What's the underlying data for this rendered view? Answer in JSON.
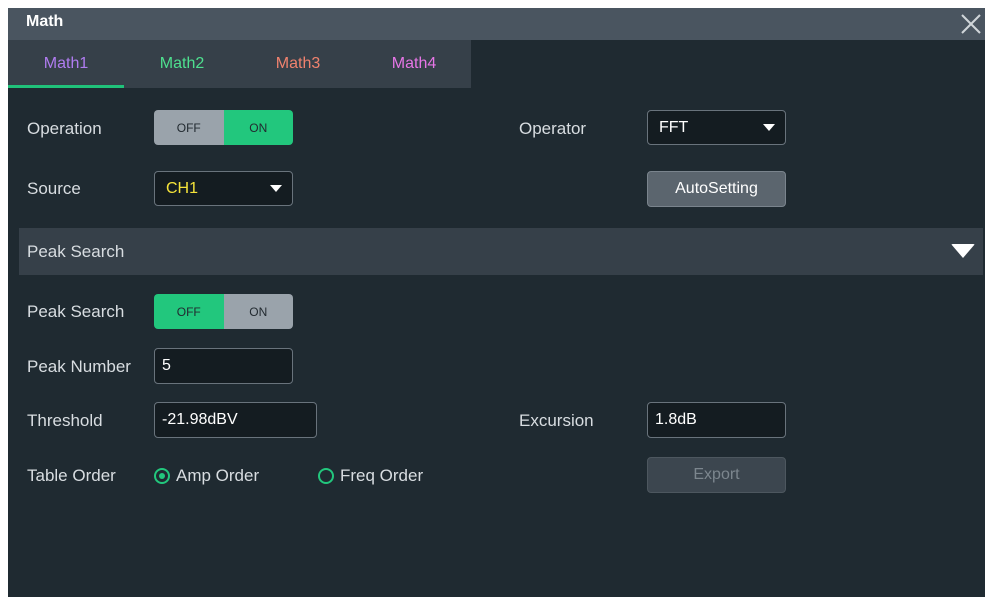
{
  "dialog": {
    "title": "Math",
    "close_icon": "close-icon"
  },
  "tabs": [
    {
      "label": "Math1",
      "color": "#b07cf0",
      "active": true
    },
    {
      "label": "Math2",
      "color": "#4ee08f",
      "active": false
    },
    {
      "label": "Math3",
      "color": "#f0826e",
      "active": false
    },
    {
      "label": "Math4",
      "color": "#e676e6",
      "active": false
    }
  ],
  "operation": {
    "label": "Operation",
    "off_label": "OFF",
    "on_label": "ON",
    "state": "ON"
  },
  "operator": {
    "label": "Operator",
    "value": "FFT"
  },
  "source": {
    "label": "Source",
    "value": "CH1",
    "value_color": "#f5e33a"
  },
  "autosetting": {
    "label": "AutoSetting"
  },
  "peak_section": {
    "title": "Peak Search",
    "icon": "triangle-down-icon"
  },
  "peak_search": {
    "label": "Peak Search",
    "off_label": "OFF",
    "on_label": "ON",
    "state": "OFF"
  },
  "peak_number": {
    "label": "Peak Number",
    "value": "5"
  },
  "threshold": {
    "label": "Threshold",
    "value": "-21.98dBV"
  },
  "excursion": {
    "label": "Excursion",
    "value": "1.8dB"
  },
  "table_order": {
    "label": "Table Order",
    "options": [
      {
        "label": "Amp Order",
        "checked": true
      },
      {
        "label": "Freq Order",
        "checked": false
      }
    ]
  },
  "export": {
    "label": "Export",
    "enabled": false
  },
  "colors": {
    "accent": "#22c77d",
    "background": "#1f2a31"
  }
}
